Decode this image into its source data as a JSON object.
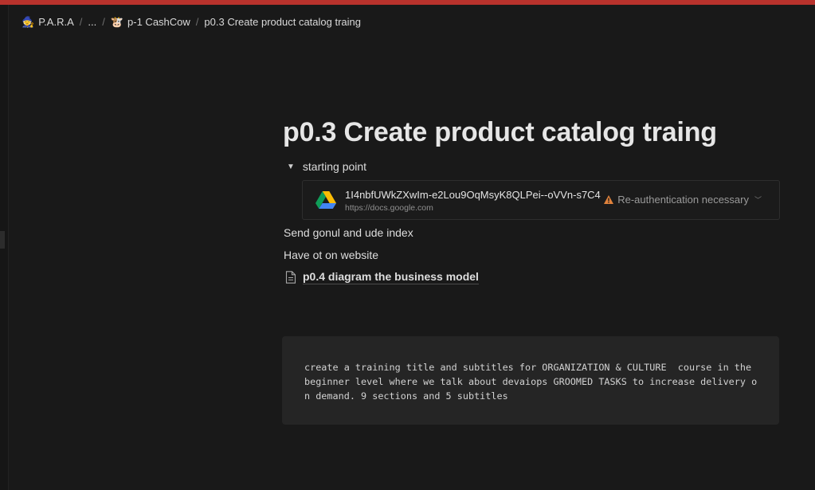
{
  "breadcrumb": {
    "items": [
      {
        "emoji": "🧙",
        "label": "P.A.R.A"
      },
      {
        "emoji": "",
        "label": "..."
      },
      {
        "emoji": "🐮",
        "label": "p-1 CashCow"
      },
      {
        "emoji": "",
        "label": "p0.3 Create product catalog traing"
      }
    ],
    "separator": "/"
  },
  "page": {
    "title": "p0.3 Create product catalog traing"
  },
  "toggle": {
    "label": "starting point",
    "expanded": true
  },
  "bookmark": {
    "title": "1I4nbfUWkZXwIm-e2Lou9OqMsyK8QLPei--oVVn-s7C4",
    "url": "https://docs.google.com",
    "status": "Re-authentication necessary",
    "icon": "google-drive-icon",
    "warning_icon": "warning-icon"
  },
  "paragraphs": [
    "Send gonul and ude index",
    "Have ot on website"
  ],
  "page_link": {
    "icon": "document-icon",
    "label": "p0.4 diagram the business model"
  },
  "code_block": {
    "lines": [
      "create a training title and subtitles for ORGANIZATION & CULTURE  course in the",
      "beginner level where we talk about devaiops GROOMED TASKS to increase delivery o",
      "n demand. 9 sections and 5 subtitles"
    ]
  },
  "colors": {
    "background": "#191919",
    "top_accent": "#b8322c",
    "warning": "#e0823c",
    "code_bg": "#252525"
  }
}
